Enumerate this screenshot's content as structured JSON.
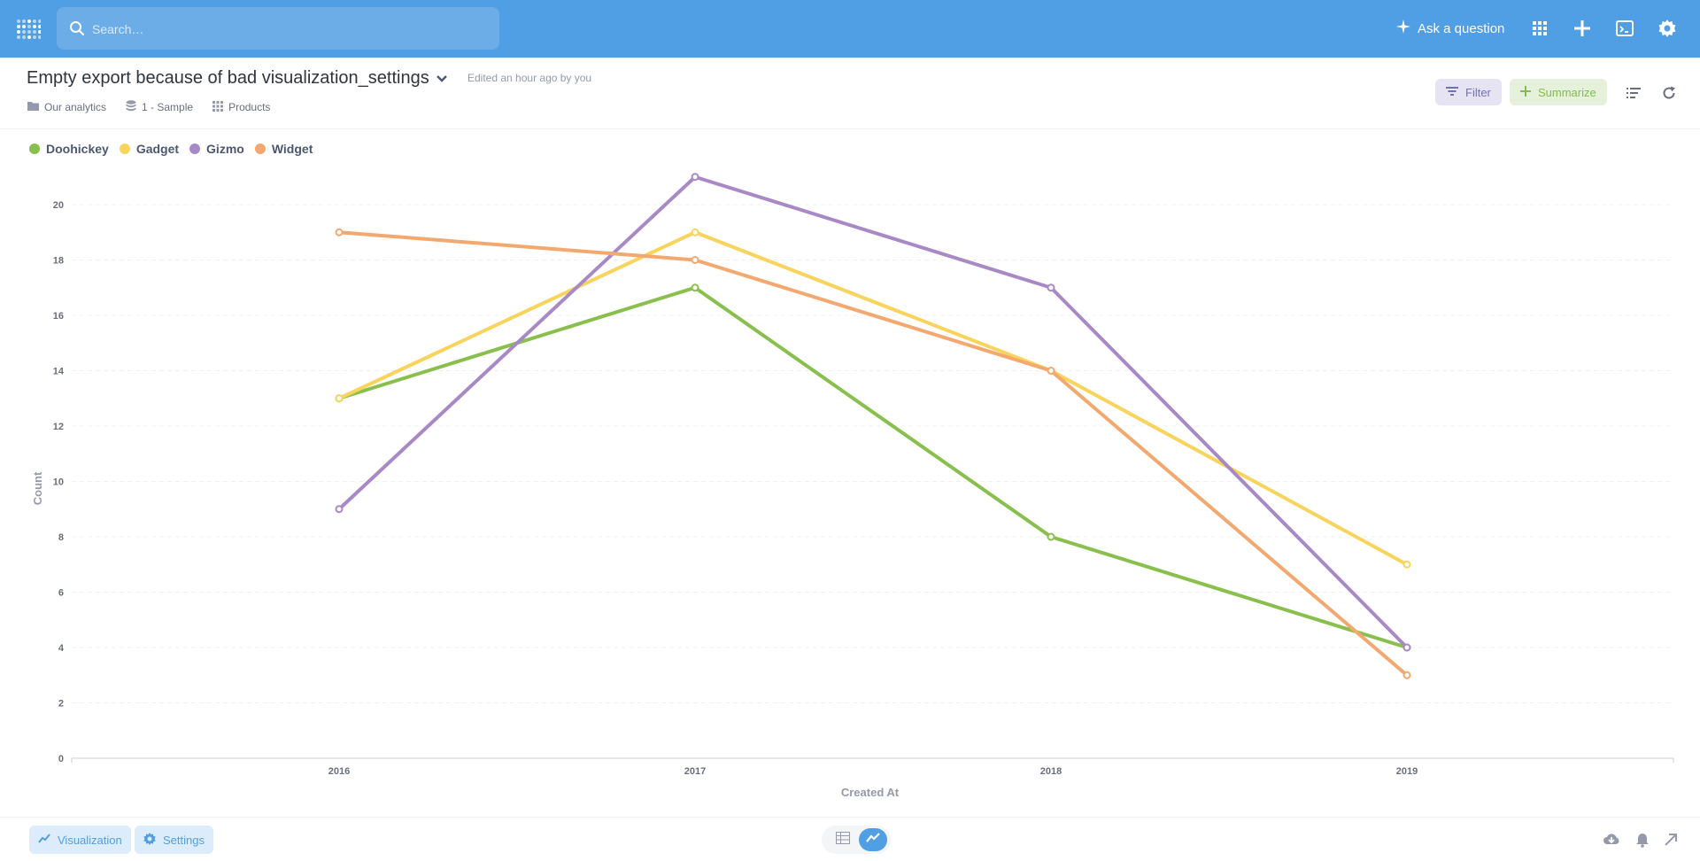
{
  "nav": {
    "search_placeholder": "Search…",
    "ask_label": "Ask a question"
  },
  "header": {
    "title": "Empty export because of bad visualization_settings",
    "edited": "Edited an hour ago by you",
    "breadcrumbs": [
      "Our analytics",
      "1 - Sample",
      "Products"
    ],
    "filter_label": "Filter",
    "summarize_label": "Summarize"
  },
  "footer": {
    "visualization_label": "Visualization",
    "settings_label": "Settings"
  },
  "colors": {
    "brand": "#509ee3",
    "Doohickey": "#88bf4d",
    "Gadget": "#f9d45c",
    "Gizmo": "#a989c5",
    "Widget": "#f2a86f"
  },
  "chart_data": {
    "type": "line",
    "x": [
      "2016",
      "2017",
      "2018",
      "2019"
    ],
    "xlabel": "Created At",
    "ylabel": "Count",
    "ylim": [
      0,
      20
    ],
    "yticks": [
      0,
      2,
      4,
      6,
      8,
      10,
      12,
      14,
      16,
      18,
      20
    ],
    "grid": true,
    "legend": "top-left",
    "series": [
      {
        "name": "Doohickey",
        "color": "#88bf4d",
        "values": [
          13,
          17,
          8,
          4
        ]
      },
      {
        "name": "Gadget",
        "color": "#f9d45c",
        "values": [
          13,
          19,
          14,
          7
        ]
      },
      {
        "name": "Gizmo",
        "color": "#a989c5",
        "values": [
          9,
          21,
          17,
          4
        ]
      },
      {
        "name": "Widget",
        "color": "#f2a86f",
        "values": [
          19,
          18,
          14,
          3
        ]
      }
    ]
  }
}
